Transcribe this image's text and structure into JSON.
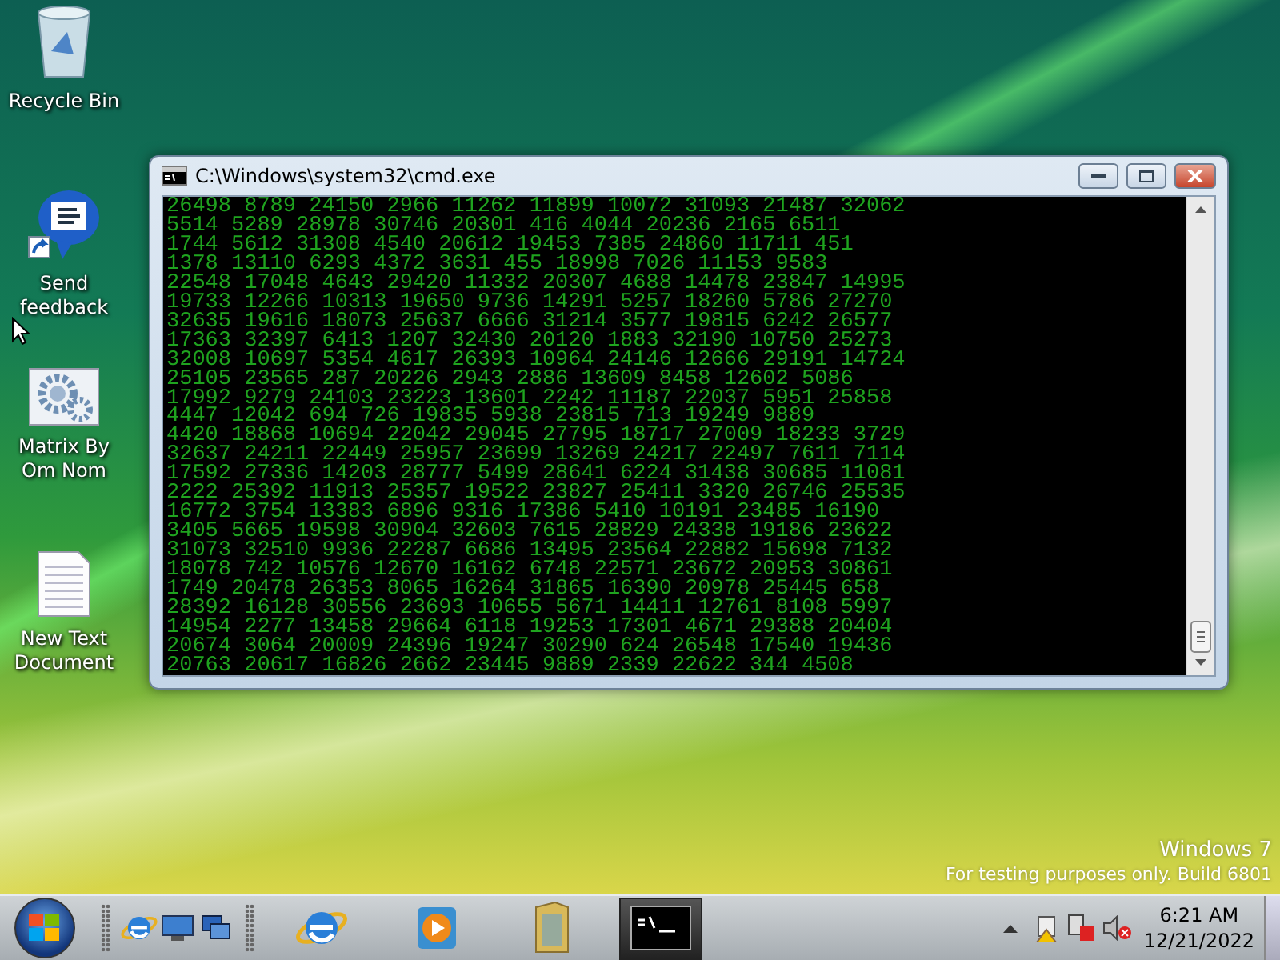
{
  "desktop_icons": [
    {
      "kind": "recycle",
      "label": "Recycle Bin"
    },
    {
      "kind": "feedback",
      "label": "Send feedback"
    },
    {
      "kind": "gears",
      "label": "Matrix By Om Nom"
    },
    {
      "kind": "document",
      "label": "New Text Document"
    }
  ],
  "window": {
    "title": "C:\\Windows\\system32\\cmd.exe",
    "lines": [
      "26498 8789 24150 2966 11262 11899 10072 31093 21487 32062",
      "5514 5289 28978 30746 20301 416 4044 20236 2165 6511",
      "1744 5612 31308 4540 20612 19453 7385 24860 11711 451",
      "1378 13110 6293 4372 3631 455 18998 7026 11153 9583",
      "22548 17048 4643 29420 11332 20307 4688 14478 23847 14995",
      "19733 12266 10313 19650 9736 14291 5257 18260 5786 27270",
      "32635 19616 18073 25637 6666 31214 3577 19815 6242 26577",
      "17363 32397 6413 1207 32430 20120 1883 32190 10750 25273",
      "32008 10697 5354 4617 26393 10964 24146 12666 29191 14724",
      "25105 23565 287 20226 2943 2886 13609 8458 12602 5086",
      "17992 9279 24103 23223 13601 2242 11187 22037 5951 25858",
      "4447 12042 694 726 19835 5938 23815 713 19249 9889",
      "4420 18868 10694 22042 29045 27795 18717 27009 18233 3729",
      "32637 24211 22449 25957 23699 13269 24217 22497 7611 7114",
      "17592 27336 14203 28777 5499 28641 6224 31438 30685 11081",
      "2222 25392 11913 25357 19522 23827 25411 3320 26746 25535",
      "16772 3754 13383 6896 9316 17386 5410 10191 23485 16190",
      "3405 5665 19598 30904 32603 7615 28829 24338 19186 23622",
      "31073 32510 9936 22287 6686 13495 23564 22882 15698 7132",
      "18078 742 10576 12670 16162 6748 22571 23672 20953 30861",
      "1749 20478 26353 8065 16264 31865 16390 20978 25445 658",
      "28392 16128 30556 23693 10655 5671 14411 12761 8108 5997",
      "14954 2277 13458 29664 6118 19253 17301 4671 29388 20404",
      "20674 3064 20009 24396 19247 30290 624 26548 17540 19436",
      "20763 20617 16826 2662 23445 9889 2339 22622 344 4508"
    ]
  },
  "os_notice": {
    "name": "Windows 7",
    "build": "For testing purposes only. Build 6801"
  },
  "taskbar": {
    "buttons": [
      {
        "kind": "browser",
        "selected": false
      },
      {
        "kind": "media",
        "selected": false
      },
      {
        "kind": "folder",
        "selected": false
      },
      {
        "kind": "console",
        "selected": true
      }
    ],
    "clock": {
      "time": "6:21 AM",
      "date": "12/21/2022"
    }
  }
}
